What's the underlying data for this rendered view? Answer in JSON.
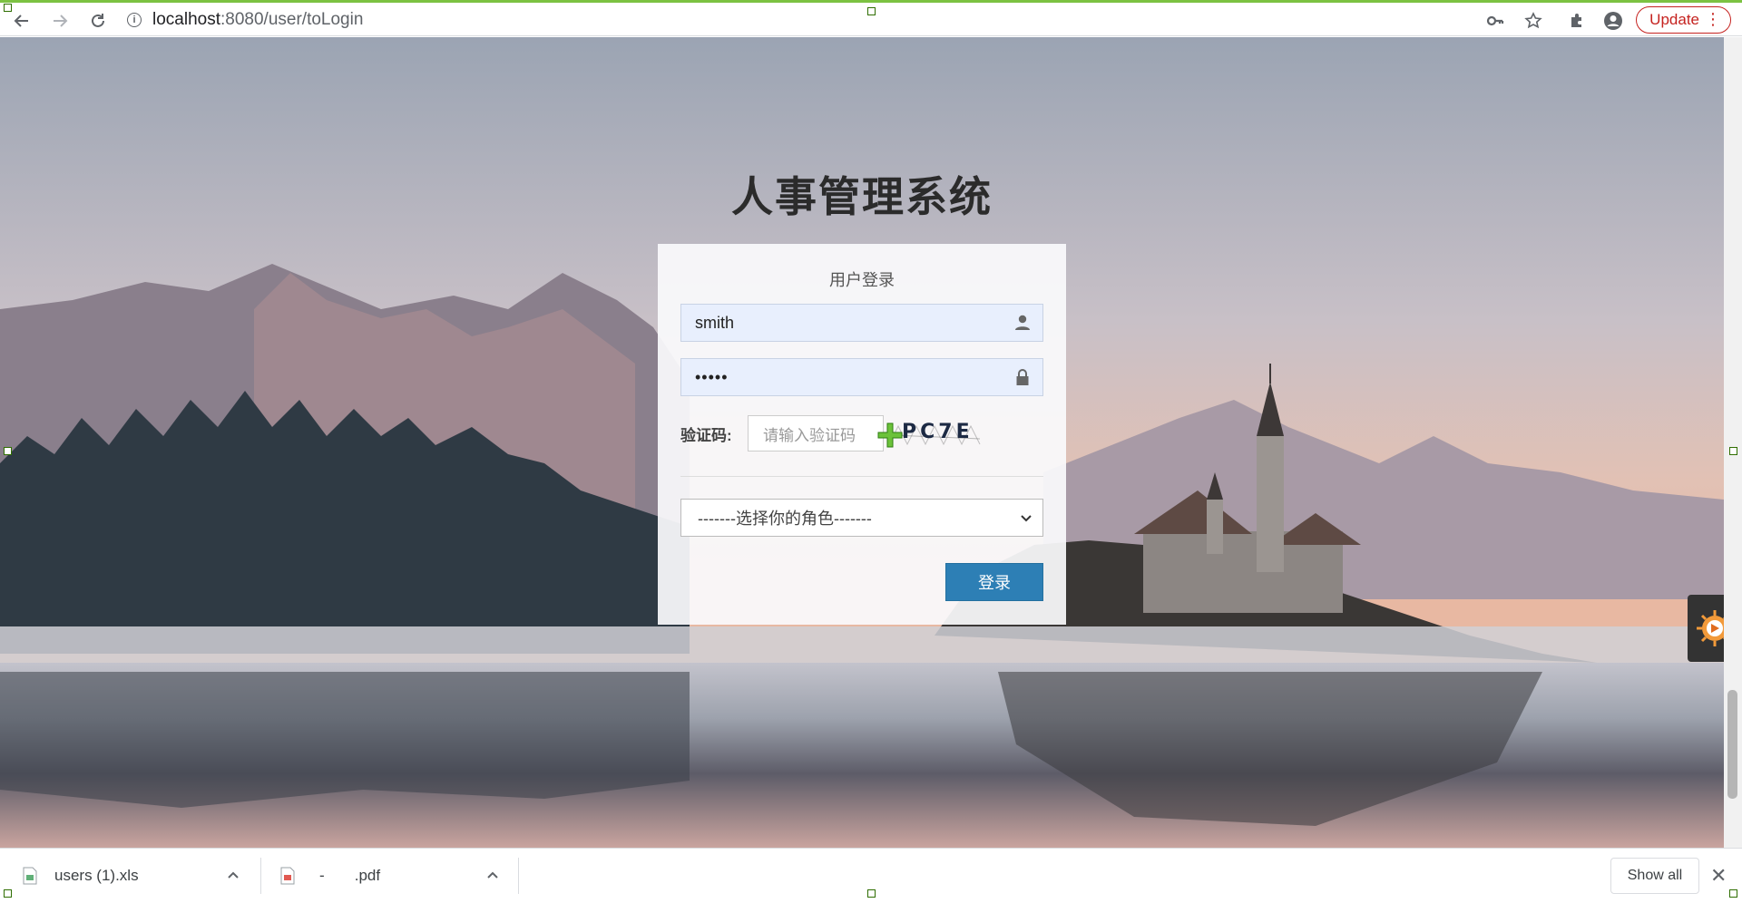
{
  "browser": {
    "url_host": "localhost",
    "url_path": ":8080/user/toLogin",
    "update_label": "Update",
    "menu_icon": "vertical-dots-icon"
  },
  "page": {
    "system_title": "人事管理系统",
    "login_heading": "用户登录",
    "username_value": "smith",
    "password_value": "•••••",
    "captcha_label": "验证码:",
    "captcha_placeholder": "请输入验证码",
    "captcha_text": "PC7E",
    "role_select_value": "-------选择你的角色-------",
    "login_button": "登录"
  },
  "downloads": {
    "items": [
      {
        "name": "users (1).xls",
        "icon": "xls-file-icon"
      },
      {
        "name": "-       .pdf",
        "icon": "pdf-file-icon"
      }
    ],
    "show_all": "Show all"
  },
  "colors": {
    "accent_button": "#2d7fb5",
    "update_red": "#c5221f",
    "input_bg": "#e8effd"
  }
}
